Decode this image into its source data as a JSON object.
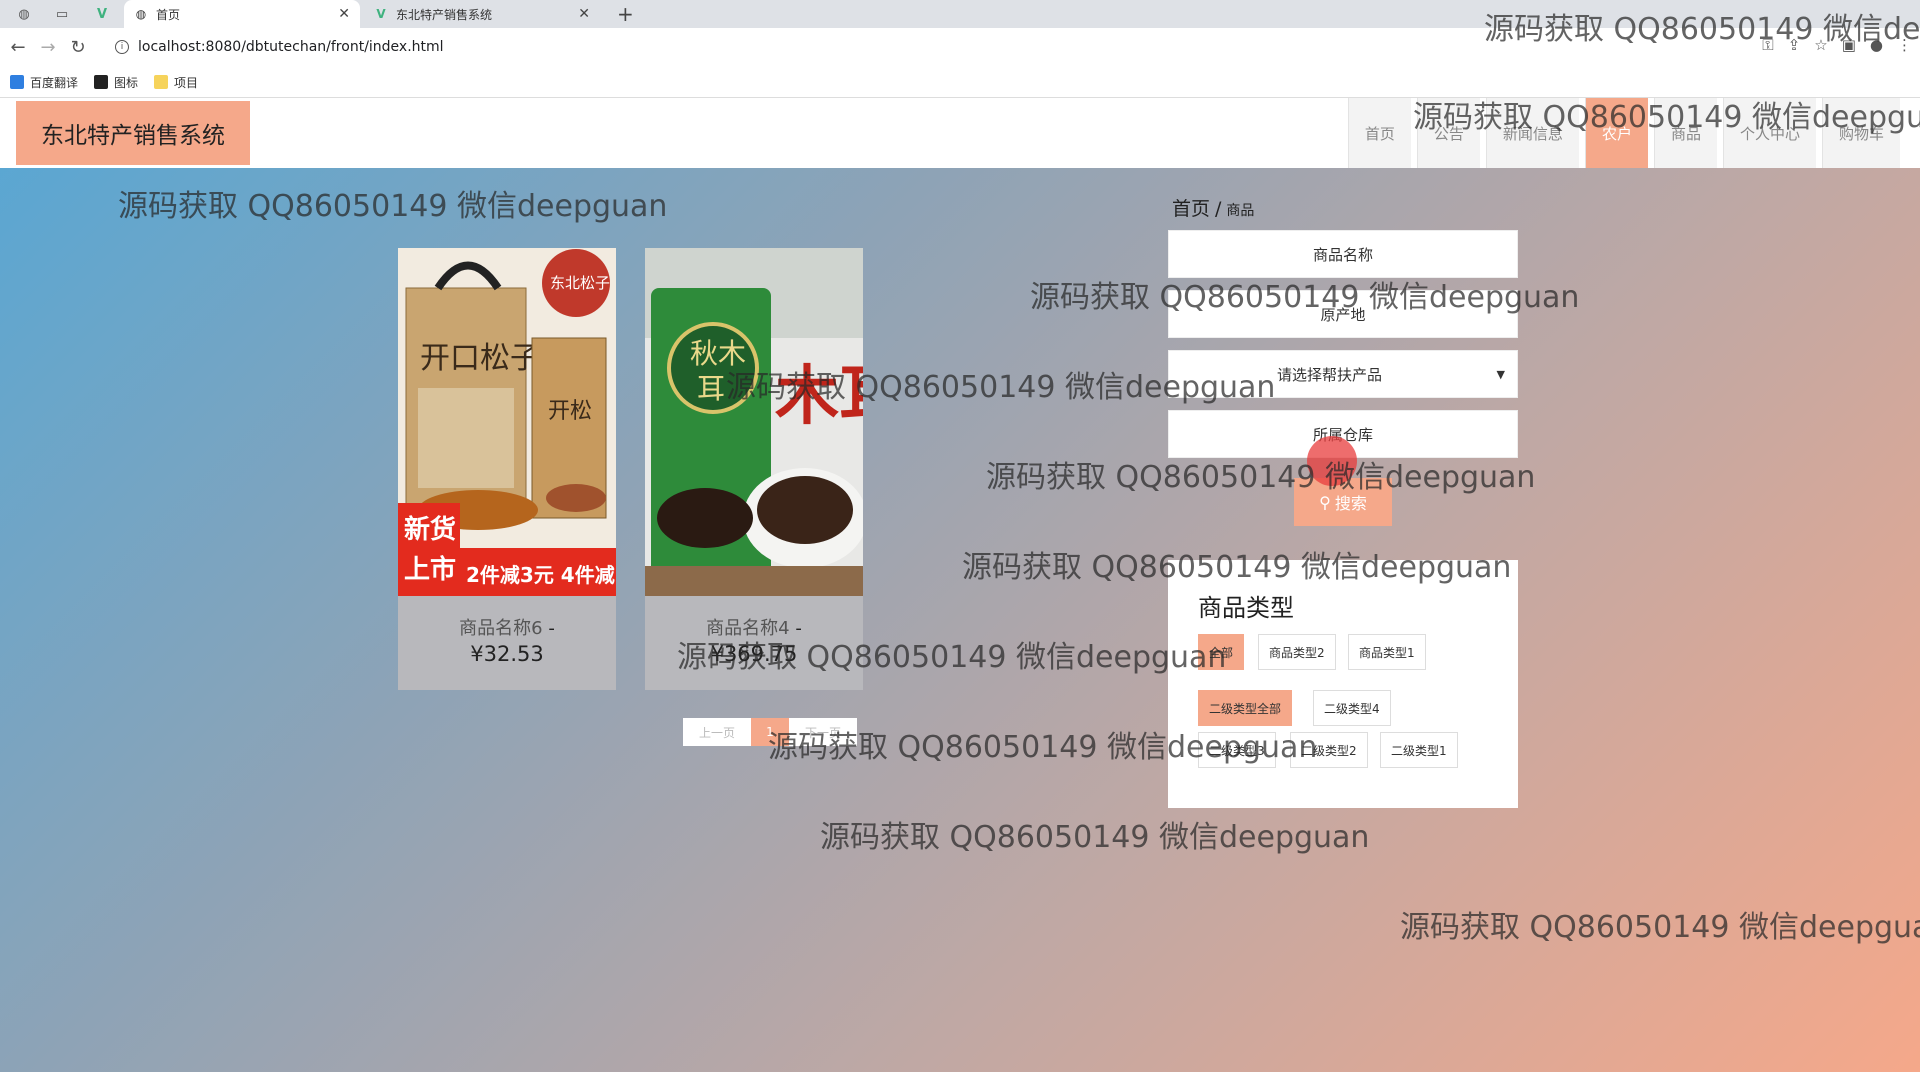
{
  "browser": {
    "tabs": [
      {
        "title": "首页"
      },
      {
        "title": "东北特产销售系统"
      }
    ],
    "url": "localhost:8080/dbtutechan/front/index.html",
    "bookmarks": [
      "百度翻译",
      "图标",
      "项目"
    ]
  },
  "site": {
    "brand": "东北特产销售系统",
    "nav": [
      "首页",
      "公告",
      "新闻信息",
      "农户",
      "商品",
      "个人中心",
      "购物车"
    ]
  },
  "breadcrumb": {
    "home": "首页",
    "separator": "/",
    "current": "商品"
  },
  "search": {
    "name_placeholder": "商品名称",
    "origin_placeholder": "原产地",
    "select_placeholder": "请选择帮扶产品",
    "warehouse_placeholder": "所属仓库",
    "button_label": "搜索"
  },
  "products": [
    {
      "name": "商品名称6",
      "dash": "-",
      "price": "¥32.53",
      "image": "pine-nuts"
    },
    {
      "name": "商品名称4",
      "dash": "-",
      "price": "¥369.75",
      "image": "black-fungus"
    }
  ],
  "pagination": {
    "prev": "上一页",
    "page": "1",
    "next": "下一页"
  },
  "categories": {
    "title": "商品类型",
    "primary": [
      "全部",
      "商品类型2",
      "商品类型1"
    ],
    "secondary": [
      "二级类型全部",
      "二级类型4",
      "二级类型3",
      "二级类型2",
      "二级类型1"
    ]
  },
  "watermark": "源码获取 QQ86050149 微信deepguan",
  "colors": {
    "accent": "#f5a88a",
    "gradient_start": "#57a7d4",
    "gradient_end": "#f5a88a"
  }
}
